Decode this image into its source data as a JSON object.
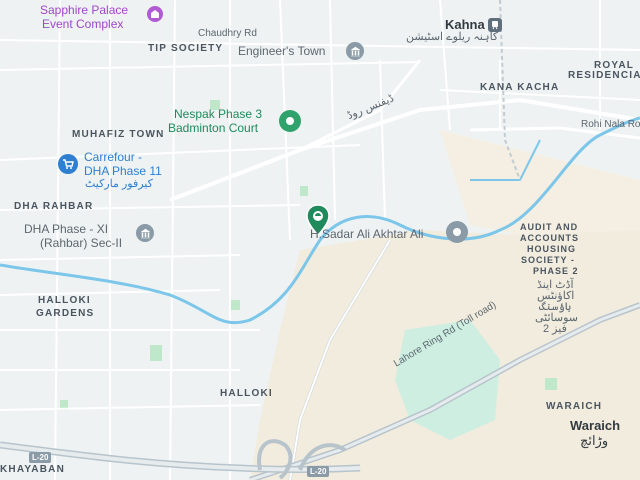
{
  "map": {
    "area_labels": {
      "tip_society": "TIP SOCIETY",
      "muhafiz_town": "MUHAFIZ TOWN",
      "dha_rahbar": "DHA RAHBAR",
      "halloki_gardens_1": "HALLOKI",
      "halloki_gardens_2": "GARDENS",
      "halloki": "HALLOKI",
      "kana_kacha": "KANA KACHA",
      "royal_residencia_1": "ROYAL",
      "royal_residencia_2": "RESIDENCIA",
      "audit_1": "AUDIT AND",
      "audit_2": "ACCOUNTS",
      "audit_3": "HOUSING",
      "audit_4": "SOCIETY -",
      "audit_5": "PHASE 2",
      "waraich_upper": "WARAICH",
      "khayaban": "KHAYABAN"
    },
    "urdu_labels": {
      "audit_urdu_1": "آڈٹ اینڈ",
      "audit_urdu_2": "اکاؤنٹس",
      "audit_urdu_3": "ہاؤسنگ",
      "audit_urdu_4": "سوسائٹی",
      "audit_urdu_5": "فیز 2",
      "waraich_urdu": "وڑائچ",
      "kahna_urdu": "کاہنہ ریلوے اسٹیشن",
      "carrefour_urdu": "کیرفور مارکیٹ",
      "road_urdu": "ڈیفنس روڈ"
    },
    "road_labels": {
      "chaudhry_rd": "Chaudhry Rd",
      "rohi_nala": "Rohi Nala Ro",
      "ring_road": "Lahore Ring Rd (Toll road)",
      "l20_a": "L-20",
      "l20_b": "L-20"
    },
    "places": {
      "sapphire_1": "Sapphire Palace",
      "sapphire_2": "Event Complex",
      "engineers_town": "Engineer's Town",
      "nespak_1": "Nespak Phase 3",
      "nespak_2": "Badminton Court",
      "carrefour_1": "Carrefour -",
      "carrefour_2": "DHA Phase 11",
      "dha_xi_1": "DHA Phase - XI",
      "dha_xi_2": "(Rahbar) Sec-II",
      "sadar_ali": "H.Sadar Ali Akhtar Ali",
      "kahna": "Kahna",
      "waraich": "Waraich"
    },
    "icons": {
      "sapphire": "event-venue-icon",
      "engineers": "landmark-icon",
      "nespak": "park-icon",
      "carrefour": "shopping-cart-icon",
      "dha_xi": "landmark-icon",
      "sadar_ali": "place-icon",
      "selected": "location-pin-icon",
      "kahna": "train-station-icon"
    },
    "colors": {
      "background": "#eef2f3",
      "water": "#7cc6ea",
      "park": "#bfe7c9",
      "road": "#ffffff",
      "highway": "#b8c4cc",
      "sand": "#f1ecdd",
      "pin_green": "#1f8a5b",
      "purple": "#a146c9",
      "blue": "#2e7fd1"
    }
  }
}
